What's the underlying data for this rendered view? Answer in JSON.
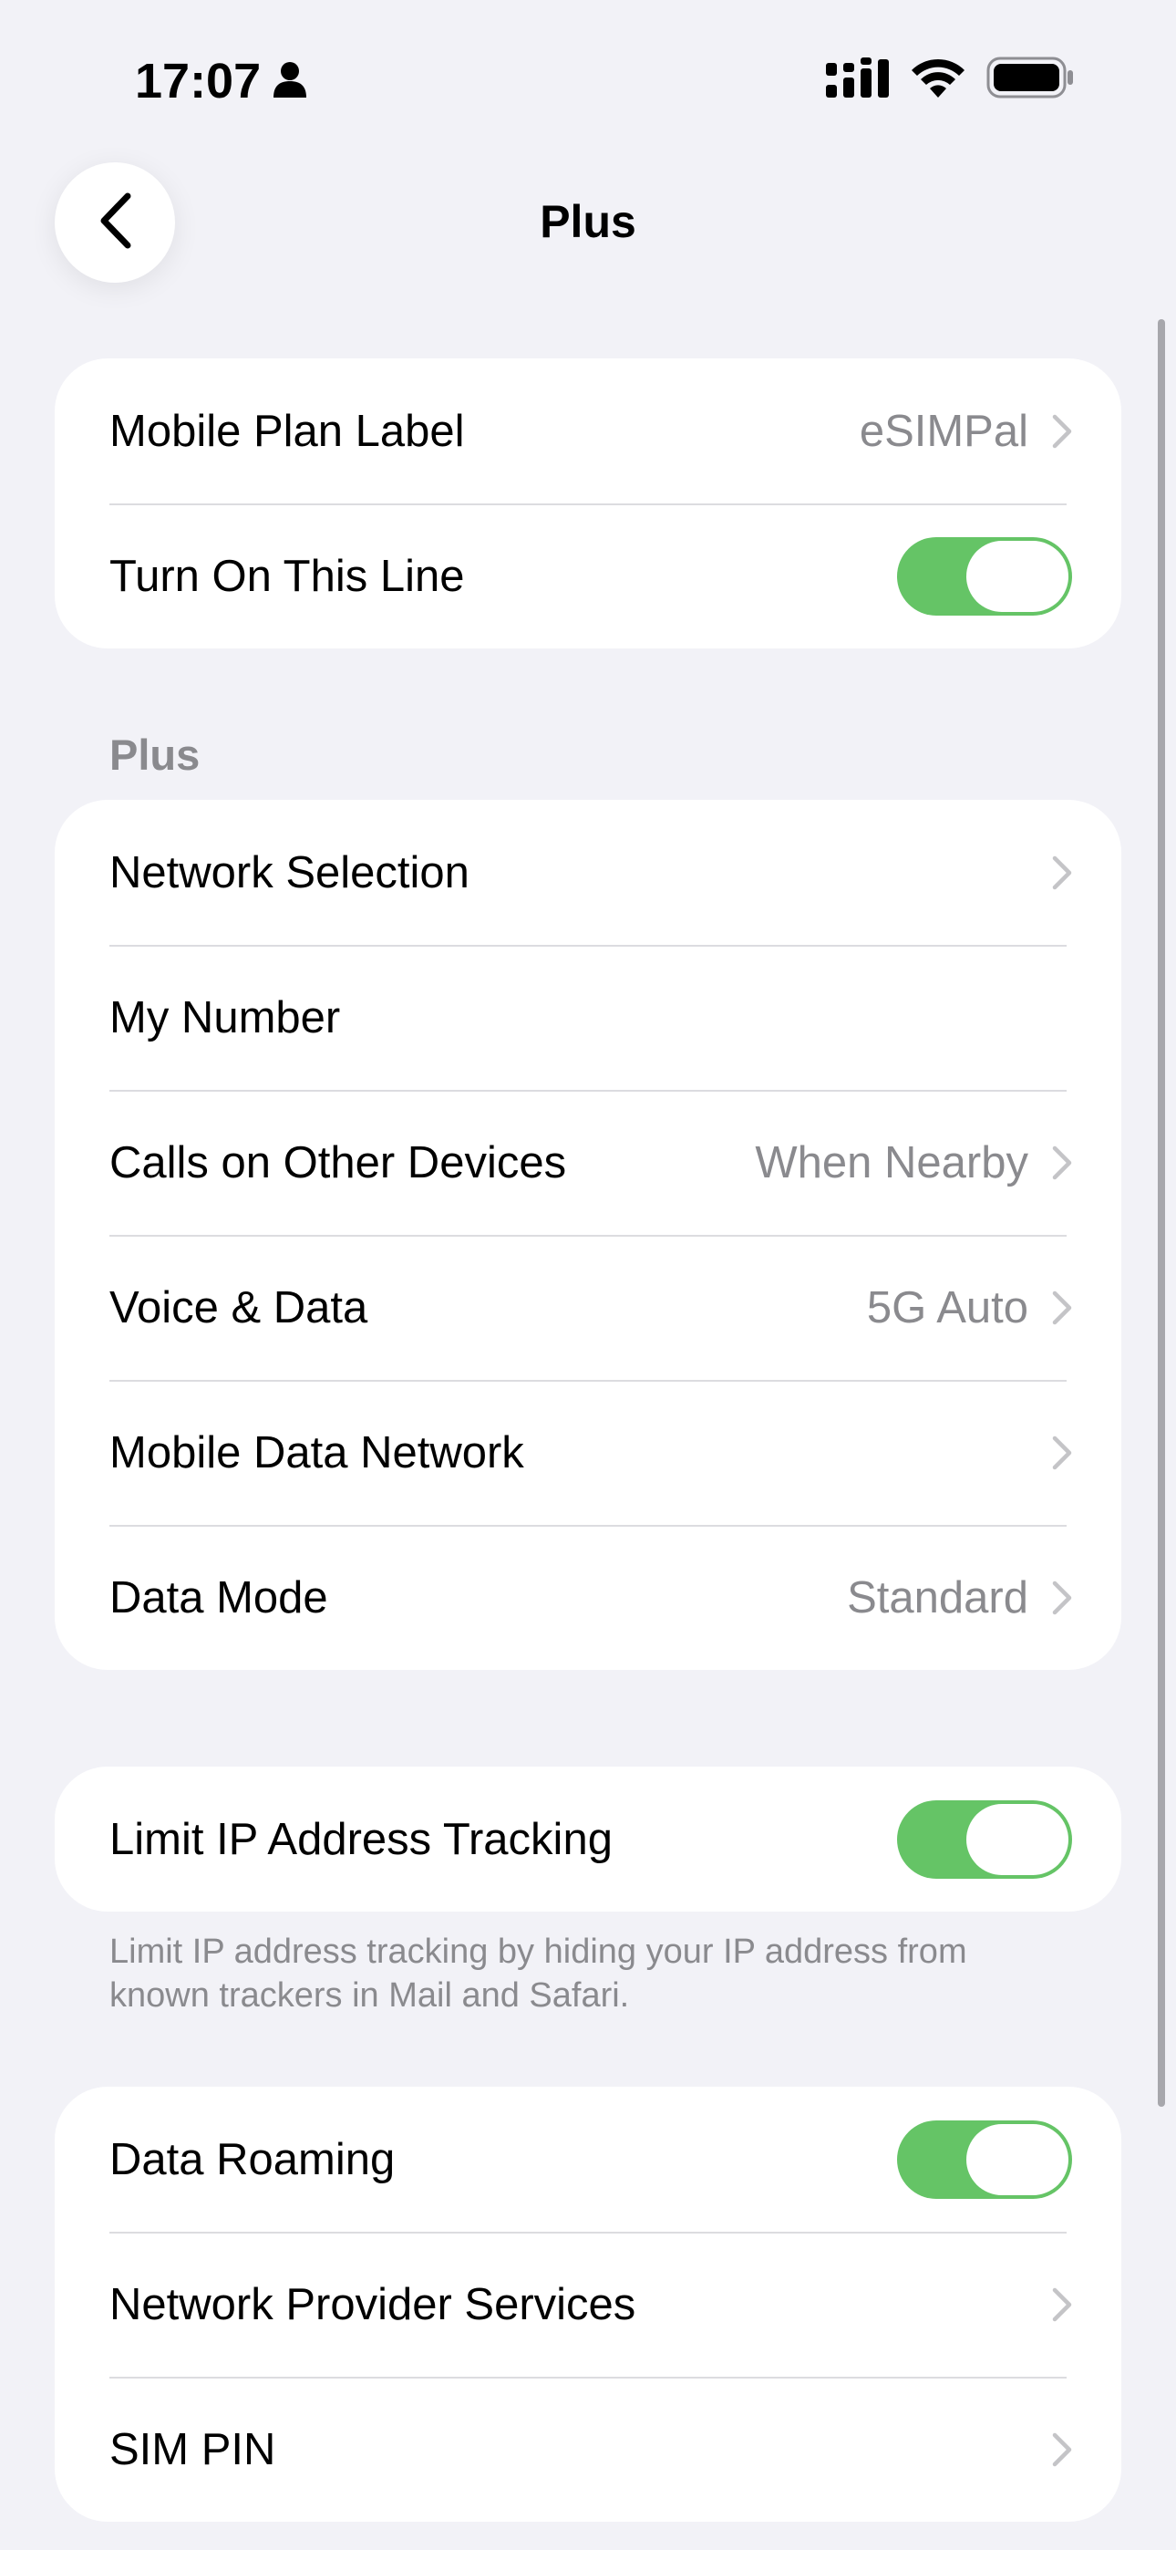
{
  "status_bar": {
    "time": "17:07",
    "person_icon": "person-icon",
    "signal_icon": "cellular-signal-icon",
    "wifi_icon": "wifi-icon",
    "battery_icon": "battery-icon"
  },
  "nav": {
    "title": "Plus",
    "back_icon": "chevron-left-icon"
  },
  "group1": {
    "plan_label": "Mobile Plan Label",
    "plan_value": "eSIMPal",
    "line_label": "Turn On This Line",
    "line_toggle": "on"
  },
  "section_plus": {
    "header": "Plus",
    "network_selection": "Network Selection",
    "my_number": "My Number",
    "calls_other_devices": "Calls on Other Devices",
    "calls_other_devices_value": "When Nearby",
    "voice_data": "Voice & Data",
    "voice_data_value": "5G Auto",
    "mobile_data_network": "Mobile Data Network",
    "data_mode": "Data Mode",
    "data_mode_value": "Standard"
  },
  "ip_tracking": {
    "label": "Limit IP Address Tracking",
    "toggle": "on",
    "footnote": "Limit IP address tracking by hiding your IP address from known trackers in Mail and Safari."
  },
  "group4": {
    "data_roaming": "Data Roaming",
    "data_roaming_toggle": "on",
    "provider_services": "Network Provider Services",
    "sim_pin": "SIM PIN"
  },
  "colors": {
    "background": "#f2f2f7",
    "toggle_on": "#65c466",
    "secondary_text": "#8a8a8e"
  }
}
